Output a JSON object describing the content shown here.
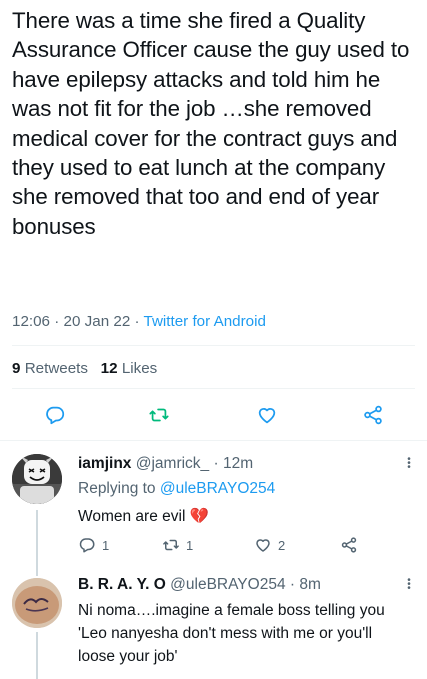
{
  "tweet": {
    "text": "There was a time she fired a Quality Assurance Officer cause the guy used to have epilepsy attacks and told him he was not fit for the job …she removed medical cover for the contract guys and they used to eat lunch at the company she removed that too and end of year bonuses",
    "time": "12:06",
    "date": "20 Jan 22",
    "separator": "·",
    "source": "Twitter for Android",
    "retweets_count": "9",
    "retweets_label": "Retweets",
    "likes_count": "12",
    "likes_label": "Likes"
  },
  "replies": [
    {
      "name": "iamjinx",
      "handle": "@jamrick_",
      "time": "12m",
      "replying_prefix": "Replying to",
      "replying_to": "@uleBRAYO254",
      "text": "Women are evil 💔",
      "reply_count": "1",
      "retweet_count": "1",
      "like_count": "2"
    },
    {
      "name": "B. R. A. Y. O",
      "handle": "@uleBRAYO254",
      "time": "8m",
      "text": "Ni noma….imagine a female boss telling you 'Leo nanyesha don't mess with me or you'll loose your job'"
    }
  ],
  "icons": {
    "reply": "reply-icon",
    "retweet": "retweet-icon",
    "like": "heart-icon",
    "share": "share-icon",
    "more": "more-icon"
  },
  "colors": {
    "accent": "#1d9bf0",
    "retweet_green": "#00ba7c",
    "text": "#0f1419",
    "muted": "#536471",
    "divider": "#eff3f4"
  }
}
